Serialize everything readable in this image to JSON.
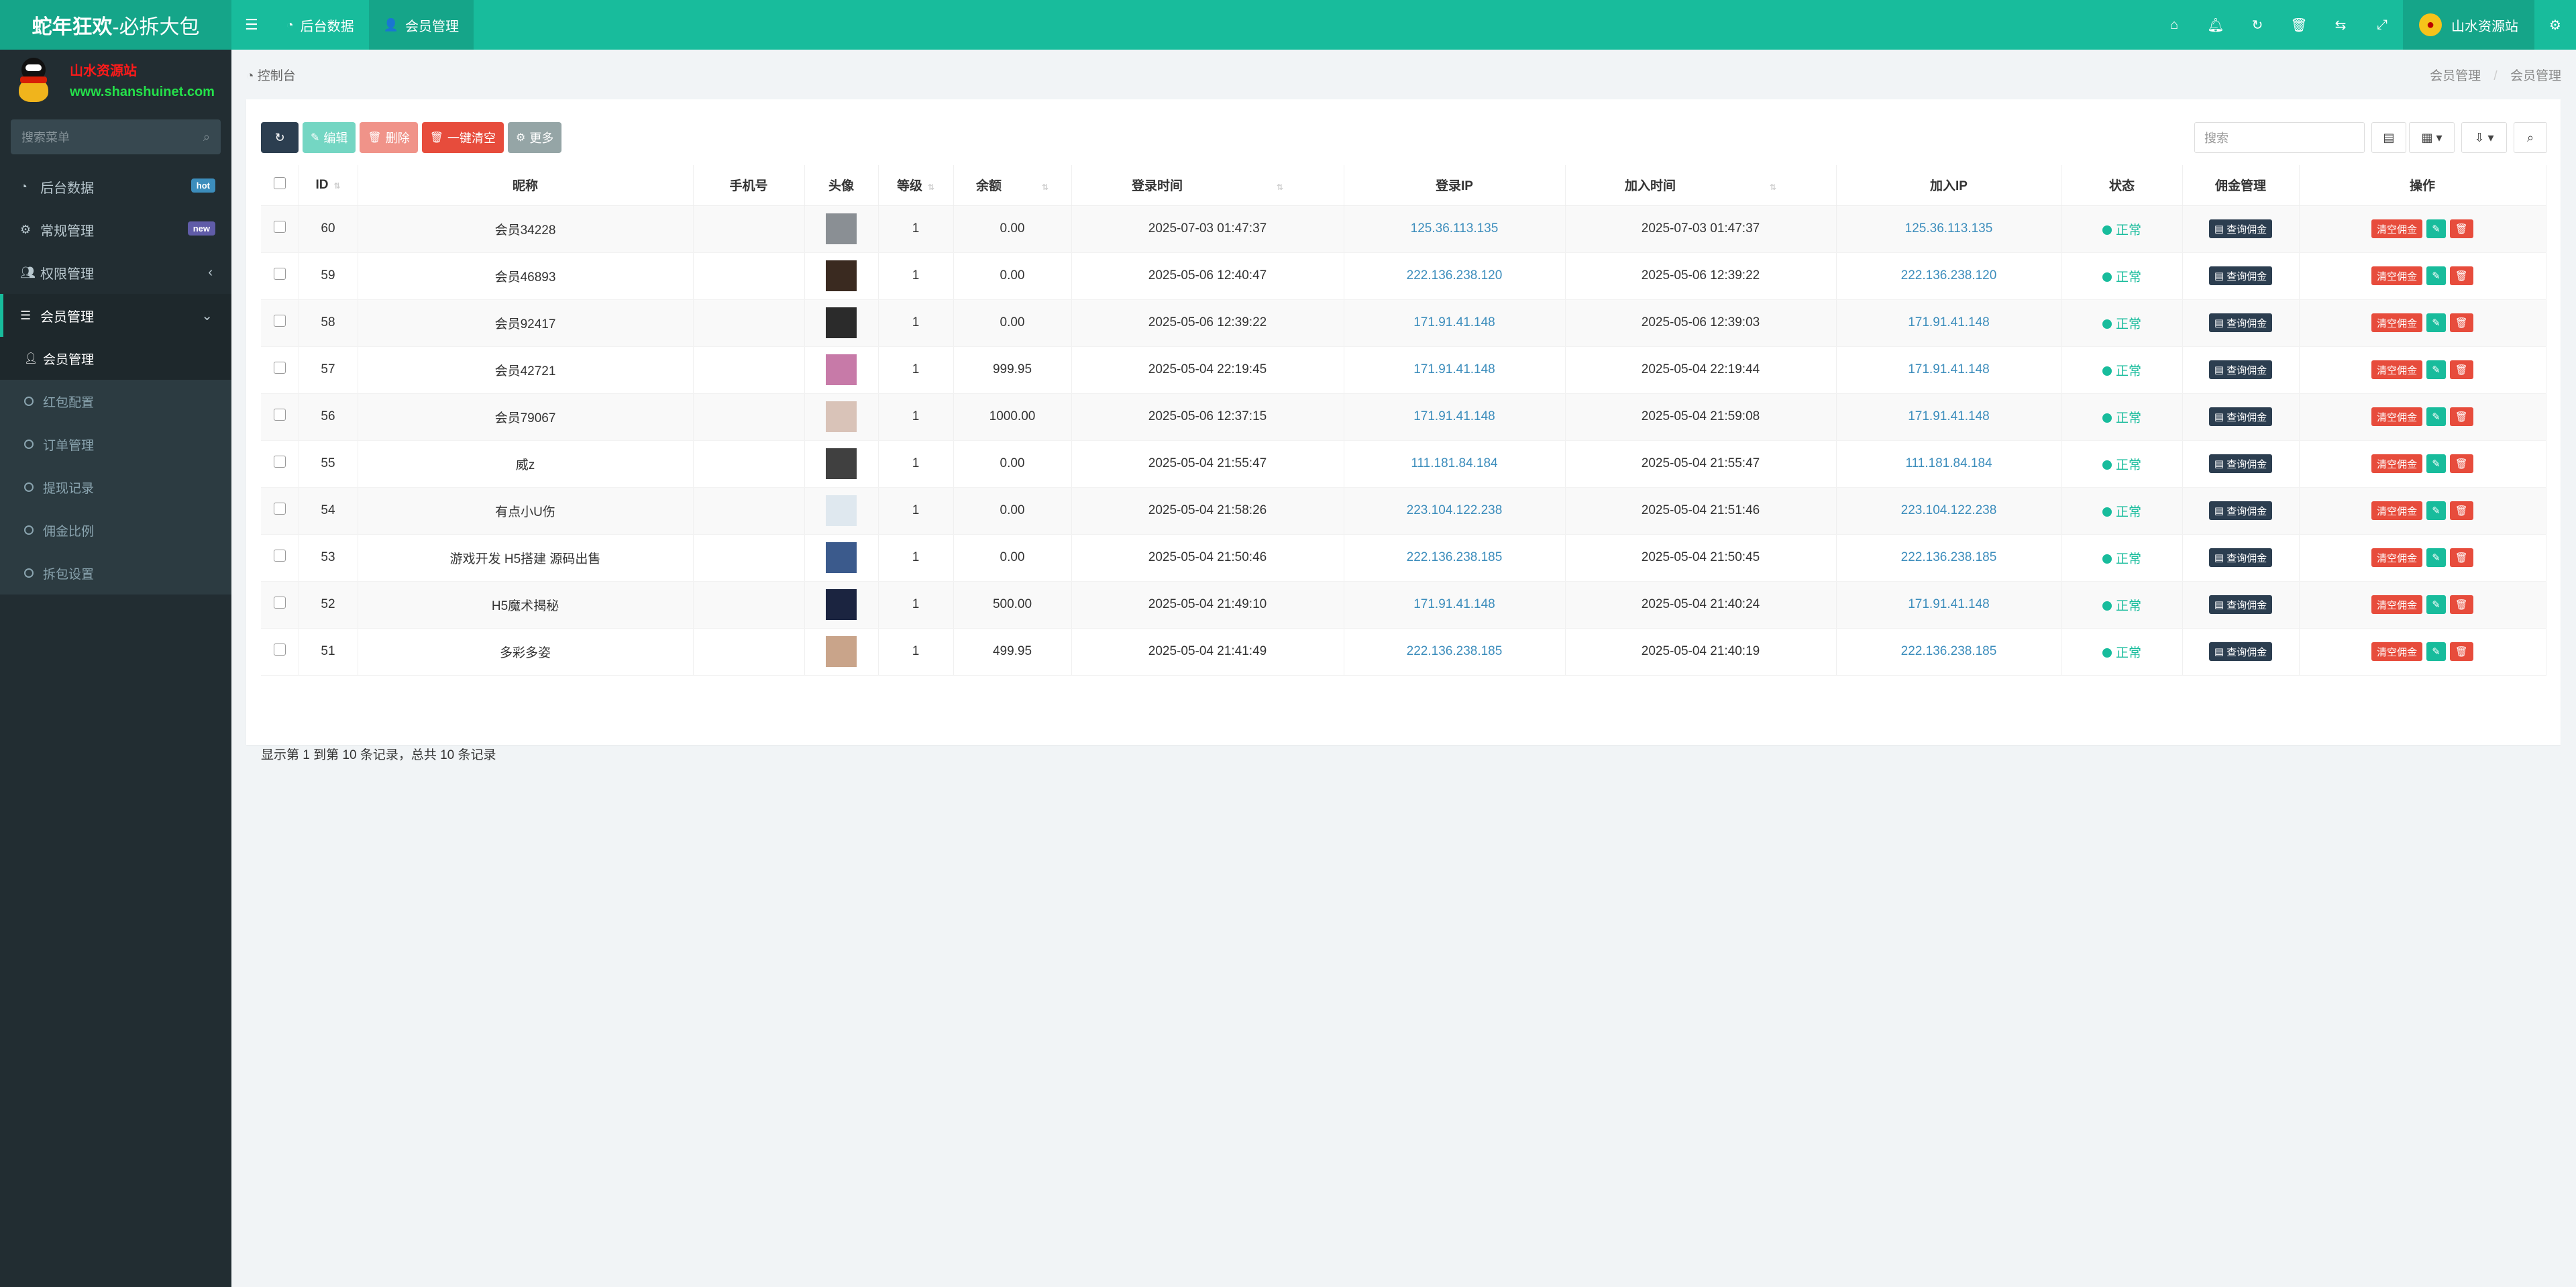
{
  "header": {
    "logo_bold": "蛇年狂欢",
    "logo_rest": "-必拆大包",
    "nav": [
      {
        "icon": "dashboard",
        "label": "后台数据"
      },
      {
        "icon": "user",
        "label": "会员管理"
      }
    ],
    "user_name": "山水资源站",
    "right_icons": [
      "home-icon",
      "bell-icon",
      "refresh-icon",
      "trash-icon",
      "translate-icon",
      "fullscreen-icon"
    ]
  },
  "sidebar": {
    "brand_line1": "山水资源站",
    "brand_line2": "www.shanshuinet.com",
    "search_placeholder": "搜索菜单",
    "items": [
      {
        "label": "后台数据",
        "badge": "hot"
      },
      {
        "label": "常规管理",
        "badge": "new"
      },
      {
        "label": "权限管理"
      },
      {
        "label": "会员管理"
      }
    ],
    "subitems": [
      {
        "label": "会员管理"
      },
      {
        "label": "红包配置"
      },
      {
        "label": "订单管理"
      },
      {
        "label": "提现记录"
      },
      {
        "label": "佣金比例"
      },
      {
        "label": "拆包设置"
      }
    ]
  },
  "breadcrumb": {
    "left": "控制台",
    "right1": "会员管理",
    "sep": "/",
    "right2": "会员管理"
  },
  "toolbar": {
    "edit": "编辑",
    "delete": "删除",
    "clear": "一键清空",
    "more": "更多",
    "search_placeholder": "搜索"
  },
  "table": {
    "headers": [
      "ID",
      "昵称",
      "手机号",
      "头像",
      "等级",
      "余额",
      "登录时间",
      "登录IP",
      "加入时间",
      "加入IP",
      "状态",
      "佣金管理",
      "操作"
    ],
    "rows": [
      {
        "id": "60",
        "nick": "会员34228",
        "phone": "",
        "level": "1",
        "balance": "0.00",
        "login_time": "2025-07-03 01:47:37",
        "login_ip": "125.36.113.135",
        "join_time": "2025-07-03 01:47:37",
        "join_ip": "125.36.113.135",
        "status": "正常"
      },
      {
        "id": "59",
        "nick": "会员46893",
        "phone": "",
        "level": "1",
        "balance": "0.00",
        "login_time": "2025-05-06 12:40:47",
        "login_ip": "222.136.238.120",
        "join_time": "2025-05-06 12:39:22",
        "join_ip": "222.136.238.120",
        "status": "正常"
      },
      {
        "id": "58",
        "nick": "会员92417",
        "phone": "",
        "level": "1",
        "balance": "0.00",
        "login_time": "2025-05-06 12:39:22",
        "login_ip": "171.91.41.148",
        "join_time": "2025-05-06 12:39:03",
        "join_ip": "171.91.41.148",
        "status": "正常"
      },
      {
        "id": "57",
        "nick": "会员42721",
        "phone": "",
        "level": "1",
        "balance": "999.95",
        "login_time": "2025-05-04 22:19:45",
        "login_ip": "171.91.41.148",
        "join_time": "2025-05-04 22:19:44",
        "join_ip": "171.91.41.148",
        "status": "正常"
      },
      {
        "id": "56",
        "nick": "会员79067",
        "phone": "",
        "level": "1",
        "balance": "1000.00",
        "login_time": "2025-05-06 12:37:15",
        "login_ip": "171.91.41.148",
        "join_time": "2025-05-04 21:59:08",
        "join_ip": "171.91.41.148",
        "status": "正常"
      },
      {
        "id": "55",
        "nick": "威z",
        "phone": "",
        "level": "1",
        "balance": "0.00",
        "login_time": "2025-05-04 21:55:47",
        "login_ip": "111.181.84.184",
        "join_time": "2025-05-04 21:55:47",
        "join_ip": "111.181.84.184",
        "status": "正常"
      },
      {
        "id": "54",
        "nick": "有点小U伤",
        "phone": "",
        "level": "1",
        "balance": "0.00",
        "login_time": "2025-05-04 21:58:26",
        "login_ip": "223.104.122.238",
        "join_time": "2025-05-04 21:51:46",
        "join_ip": "223.104.122.238",
        "status": "正常"
      },
      {
        "id": "53",
        "nick": "游戏开发 H5搭建 源码出售",
        "phone": "",
        "level": "1",
        "balance": "0.00",
        "login_time": "2025-05-04 21:50:46",
        "login_ip": "222.136.238.185",
        "join_time": "2025-05-04 21:50:45",
        "join_ip": "222.136.238.185",
        "status": "正常"
      },
      {
        "id": "52",
        "nick": "H5魔术揭秘",
        "phone": "",
        "level": "1",
        "balance": "500.00",
        "login_time": "2025-05-04 21:49:10",
        "login_ip": "171.91.41.148",
        "join_time": "2025-05-04 21:40:24",
        "join_ip": "171.91.41.148",
        "status": "正常"
      },
      {
        "id": "51",
        "nick": "多彩多姿",
        "phone": "",
        "level": "1",
        "balance": "499.95",
        "login_time": "2025-05-04 21:41:49",
        "login_ip": "222.136.238.185",
        "join_time": "2025-05-04 21:40:19",
        "join_ip": "222.136.238.185",
        "status": "正常"
      }
    ],
    "commission_btn": "查询佣金",
    "clear_btn": "清空佣金",
    "avatar_colors": [
      "#8a8f94",
      "#3a2a20",
      "#2b2b2b",
      "#c77aa8",
      "#d9c3b8",
      "#404040",
      "#dfe8ef",
      "#3b5a8c",
      "#1b2440",
      "#c9a48a"
    ]
  },
  "pager_text": "显示第 1 到第 10 条记录，总共 10 条记录"
}
